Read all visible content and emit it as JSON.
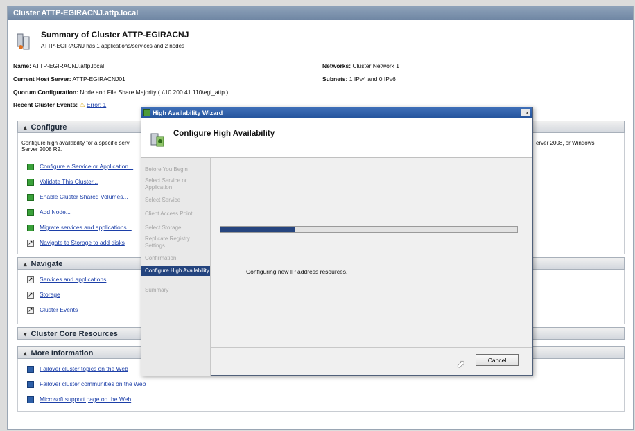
{
  "window": {
    "title": "Cluster ATTP-EGIRACNJ.attp.local"
  },
  "summary": {
    "title": "Summary of Cluster ATTP-EGIRACNJ",
    "subtitle": "ATTP-EGIRACNJ has 1 applications/services and 2 nodes"
  },
  "info": {
    "name_label": "Name:",
    "name_value": "ATTP-EGIRACNJ.attp.local",
    "host_label": "Current Host Server:",
    "host_value": "ATTP-EGIRACNJ01",
    "quorum_label": "Quorum Configuration:",
    "quorum_value": "Node and File Share Majority ( \\\\10.200.41.110\\egi_attp )",
    "events_label": "Recent Cluster Events:",
    "events_value": "Error: 1",
    "networks_label": "Networks:",
    "networks_value": "Cluster Network 1",
    "subnets_label": "Subnets:",
    "subnets_value": "1 IPv4 and 0 IPv6"
  },
  "sections": {
    "configure": {
      "title": "Configure",
      "description_left": "Configure high availability for a specific serv",
      "description_left2": "Server 2008 R2.",
      "description_right": "erver 2008, or Windows",
      "actions": [
        "Configure a Service or Application...",
        "Validate This Cluster...",
        "Enable Cluster Shared Volumes...",
        "Add Node...",
        "Migrate services and applications...",
        "Navigate to Storage to add disks"
      ]
    },
    "navigate": {
      "title": "Navigate",
      "links": [
        "Services and applications",
        "Storage",
        "Cluster Events"
      ]
    },
    "core": {
      "title": "Cluster Core Resources"
    },
    "more_info": {
      "title": "More Information",
      "links": [
        "Failover cluster topics on the Web",
        "Failover cluster communities on the Web",
        "Microsoft support page on the Web"
      ]
    }
  },
  "wizard": {
    "title": "High Availability Wizard",
    "close_label": "×",
    "header_title": "Configure High Availability",
    "steps": [
      "Before You Begin",
      "Select Service or Application",
      "Select Service",
      "Client Access Point",
      "Select Storage",
      "Replicate Registry Settings",
      "Confirmation",
      "Configure High Availability",
      "Summary"
    ],
    "active_step_index": 7,
    "progress_fraction": 0.25,
    "status_text": "Configuring new IP address resources.",
    "cancel_label": "Cancel"
  }
}
